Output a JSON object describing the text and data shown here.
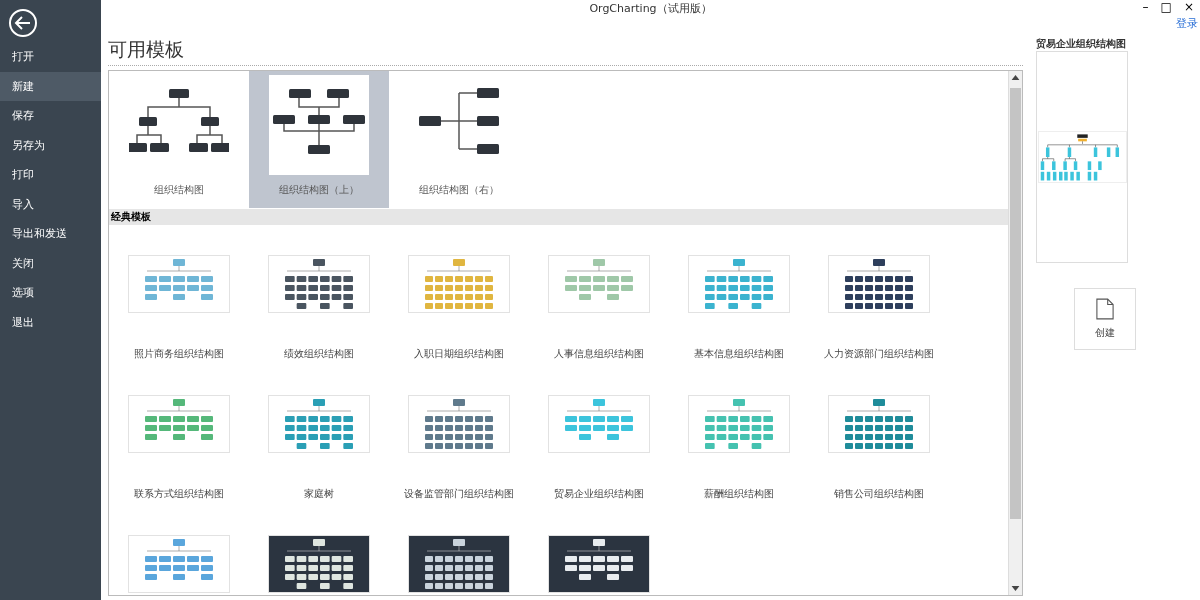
{
  "window": {
    "title": "OrgCharting（试用版）",
    "controls": [
      "–",
      "□",
      "×"
    ]
  },
  "login": "登录",
  "sidebar": {
    "items": [
      {
        "label": "打开",
        "selected": false
      },
      {
        "label": "新建",
        "selected": true
      },
      {
        "label": "保存",
        "selected": false
      },
      {
        "label": "另存为",
        "selected": false
      },
      {
        "label": "打印",
        "selected": false
      },
      {
        "label": "导入",
        "selected": false
      },
      {
        "label": "导出和发送",
        "selected": false
      },
      {
        "label": "关闭",
        "selected": false
      },
      {
        "label": "选项",
        "selected": false
      },
      {
        "label": "退出",
        "selected": false
      }
    ]
  },
  "heading": "可用模板",
  "basic_templates": [
    {
      "label": "组织结构图",
      "kind": "tree",
      "selected": false
    },
    {
      "label": "组织结构图（上）",
      "kind": "top",
      "selected": true
    },
    {
      "label": "组织结构图（右）",
      "kind": "right",
      "selected": false
    }
  ],
  "section_title": "经典模板",
  "classic_templates": [
    {
      "label": "照片商务组织结构图",
      "color": "#6fb6d6",
      "dark": false,
      "selected": false
    },
    {
      "label": "绩效组织结构图",
      "color": "#4a5560",
      "dark": false,
      "selected": false
    },
    {
      "label": "入职日期组织结构图",
      "color": "#e0b640",
      "dark": false,
      "selected": false
    },
    {
      "label": "人事信息组织结构图",
      "color": "#9fc8a8",
      "dark": false,
      "selected": false
    },
    {
      "label": "基本信息组织结构图",
      "color": "#3bb3cf",
      "dark": false,
      "selected": false
    },
    {
      "label": "人力资源部门组织结构图",
      "color": "#2e3f5c",
      "dark": false,
      "selected": false
    },
    {
      "label": "联系方式组织结构图",
      "color": "#55b87a",
      "dark": false,
      "selected": false
    },
    {
      "label": "家庭树",
      "color": "#2a9fb5",
      "dark": false,
      "selected": false
    },
    {
      "label": "设备监管部门组织结构图",
      "color": "#5f7a8c",
      "dark": false,
      "selected": false
    },
    {
      "label": "贸易企业组织结构图",
      "color": "#3cc4dc",
      "dark": false,
      "selected": false
    },
    {
      "label": "薪酬组织结构图",
      "color": "#45c2b0",
      "dark": false,
      "selected": false
    },
    {
      "label": "销售公司组织结构图",
      "color": "#1f8c9a",
      "dark": false,
      "selected": false
    },
    {
      "color": "#5aa6dc",
      "dark": false,
      "selected": false
    },
    {
      "color": "#dfe6e0",
      "dark": true,
      "selected": false
    },
    {
      "color": "#c9d3dc",
      "dark": true,
      "selected": false
    },
    {
      "color": "#e8ecef",
      "dark": true,
      "selected": false
    }
  ],
  "preview": {
    "title": "贸易企业组织结构图",
    "color": "#3cc4dc"
  },
  "create_button": "创建"
}
